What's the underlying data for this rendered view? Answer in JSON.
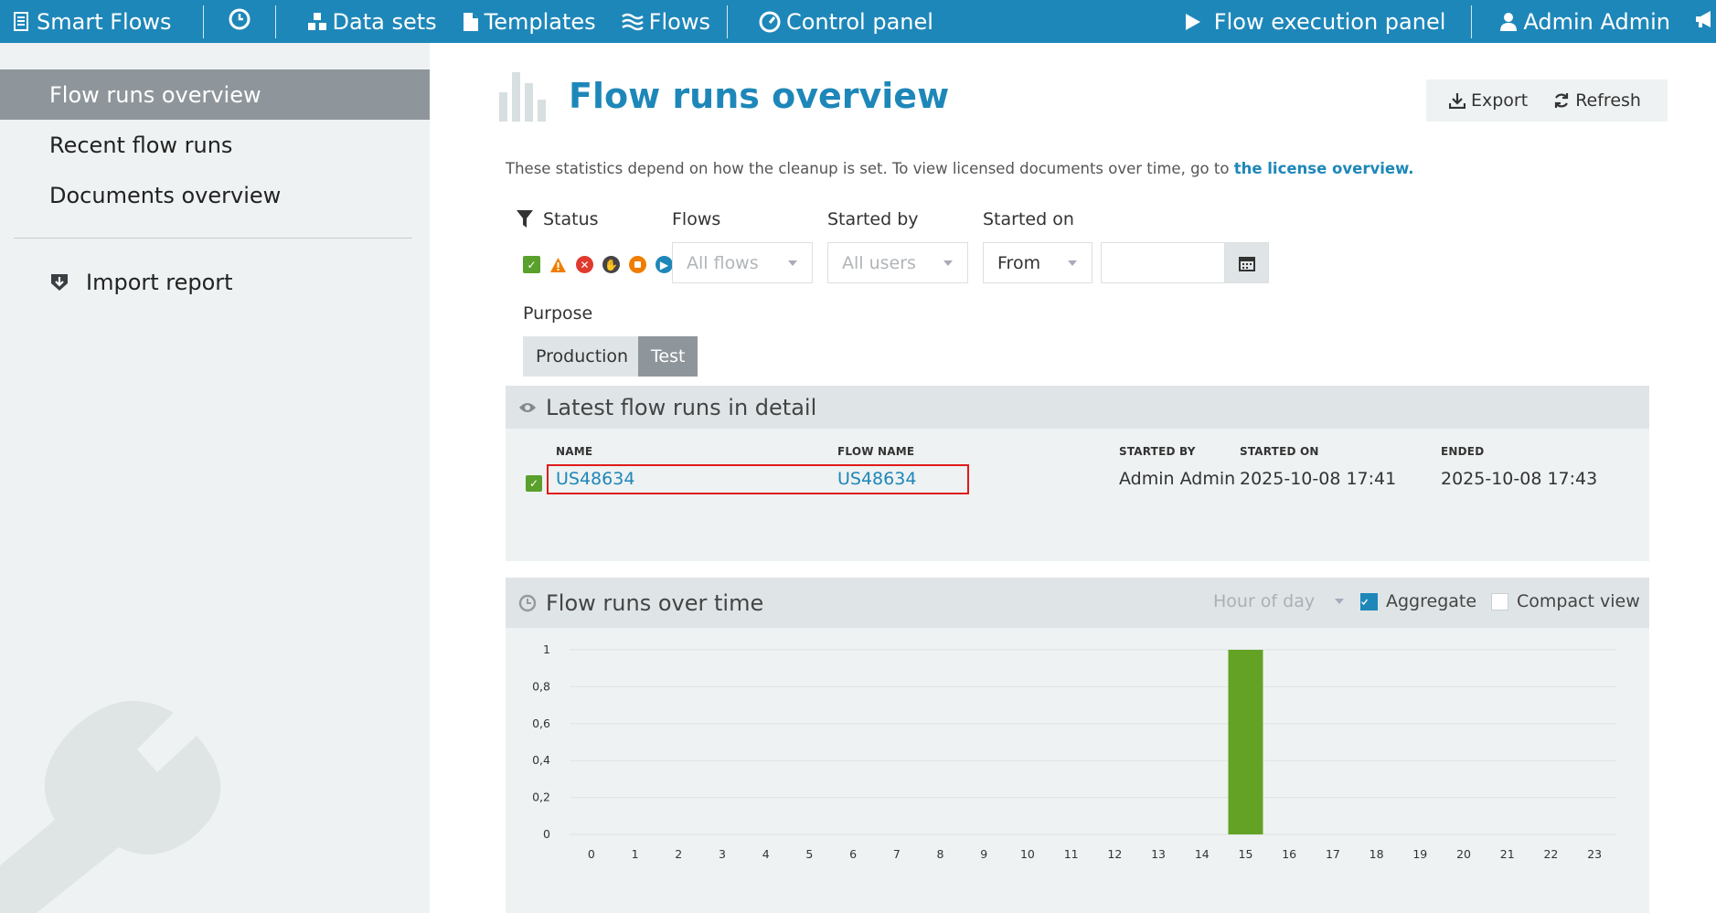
{
  "nav": {
    "brand": "Smart Flows",
    "datasets": "Data sets",
    "templates": "Templates",
    "flows": "Flows",
    "control_panel": "Control panel",
    "flow_execution": "Flow execution panel",
    "user": "Admin Admin"
  },
  "sidebar": {
    "items": [
      {
        "label": "Flow runs overview"
      },
      {
        "label": "Recent flow runs"
      },
      {
        "label": "Documents overview"
      },
      {
        "label": "Import report"
      }
    ]
  },
  "page": {
    "title": "Flow runs overview",
    "export": "Export",
    "refresh": "Refresh",
    "notice": "These statistics depend on how the cleanup is set. To view licensed documents over time, go to ",
    "notice_link": "the license overview."
  },
  "filters": {
    "status_label": "Status",
    "flows_label": "Flows",
    "flows_placeholder": "All flows",
    "started_by_label": "Started by",
    "started_by_placeholder": "All users",
    "started_on_label": "Started on",
    "started_on_value": "From",
    "purpose_label": "Purpose",
    "purpose_options": [
      "Production",
      "Test"
    ],
    "status_colors": [
      "#5aa02c",
      "#f07d00",
      "#e03a2f",
      "#444444",
      "#f07d00",
      "#1e87b9",
      "#2a5f86",
      "#4fc1c9",
      "#d9a420",
      "#d29093"
    ]
  },
  "latest": {
    "title": "Latest flow runs in detail",
    "headers": {
      "name": "NAME",
      "flow_name": "FLOW NAME",
      "started_by": "STARTED BY",
      "started_on": "STARTED ON",
      "ended": "ENDED"
    },
    "rows": [
      {
        "name": "US48634",
        "flow_name": "US48634",
        "started_by": "Admin Admin",
        "started_on": "2025-10-08 17:41",
        "ended": "2025-10-08 17:43"
      }
    ]
  },
  "over_time": {
    "title": "Flow runs over time",
    "granularity": "Hour of day",
    "aggregate_label": "Aggregate",
    "aggregate_checked": true,
    "compact_label": "Compact view",
    "compact_checked": false
  },
  "chart_data": {
    "type": "bar",
    "categories": [
      "0",
      "1",
      "2",
      "3",
      "4",
      "5",
      "6",
      "7",
      "8",
      "9",
      "10",
      "11",
      "12",
      "13",
      "14",
      "15",
      "16",
      "17",
      "18",
      "19",
      "20",
      "21",
      "22",
      "23"
    ],
    "values": [
      0,
      0,
      0,
      0,
      0,
      0,
      0,
      0,
      0,
      0,
      0,
      0,
      0,
      0,
      0,
      1,
      0,
      0,
      0,
      0,
      0,
      0,
      0,
      0
    ],
    "yticks": [
      "0",
      "0,2",
      "0,4",
      "0,6",
      "0,8",
      "1"
    ],
    "ylim": [
      0,
      1
    ],
    "grid": true,
    "bar_color": "#63a224"
  }
}
